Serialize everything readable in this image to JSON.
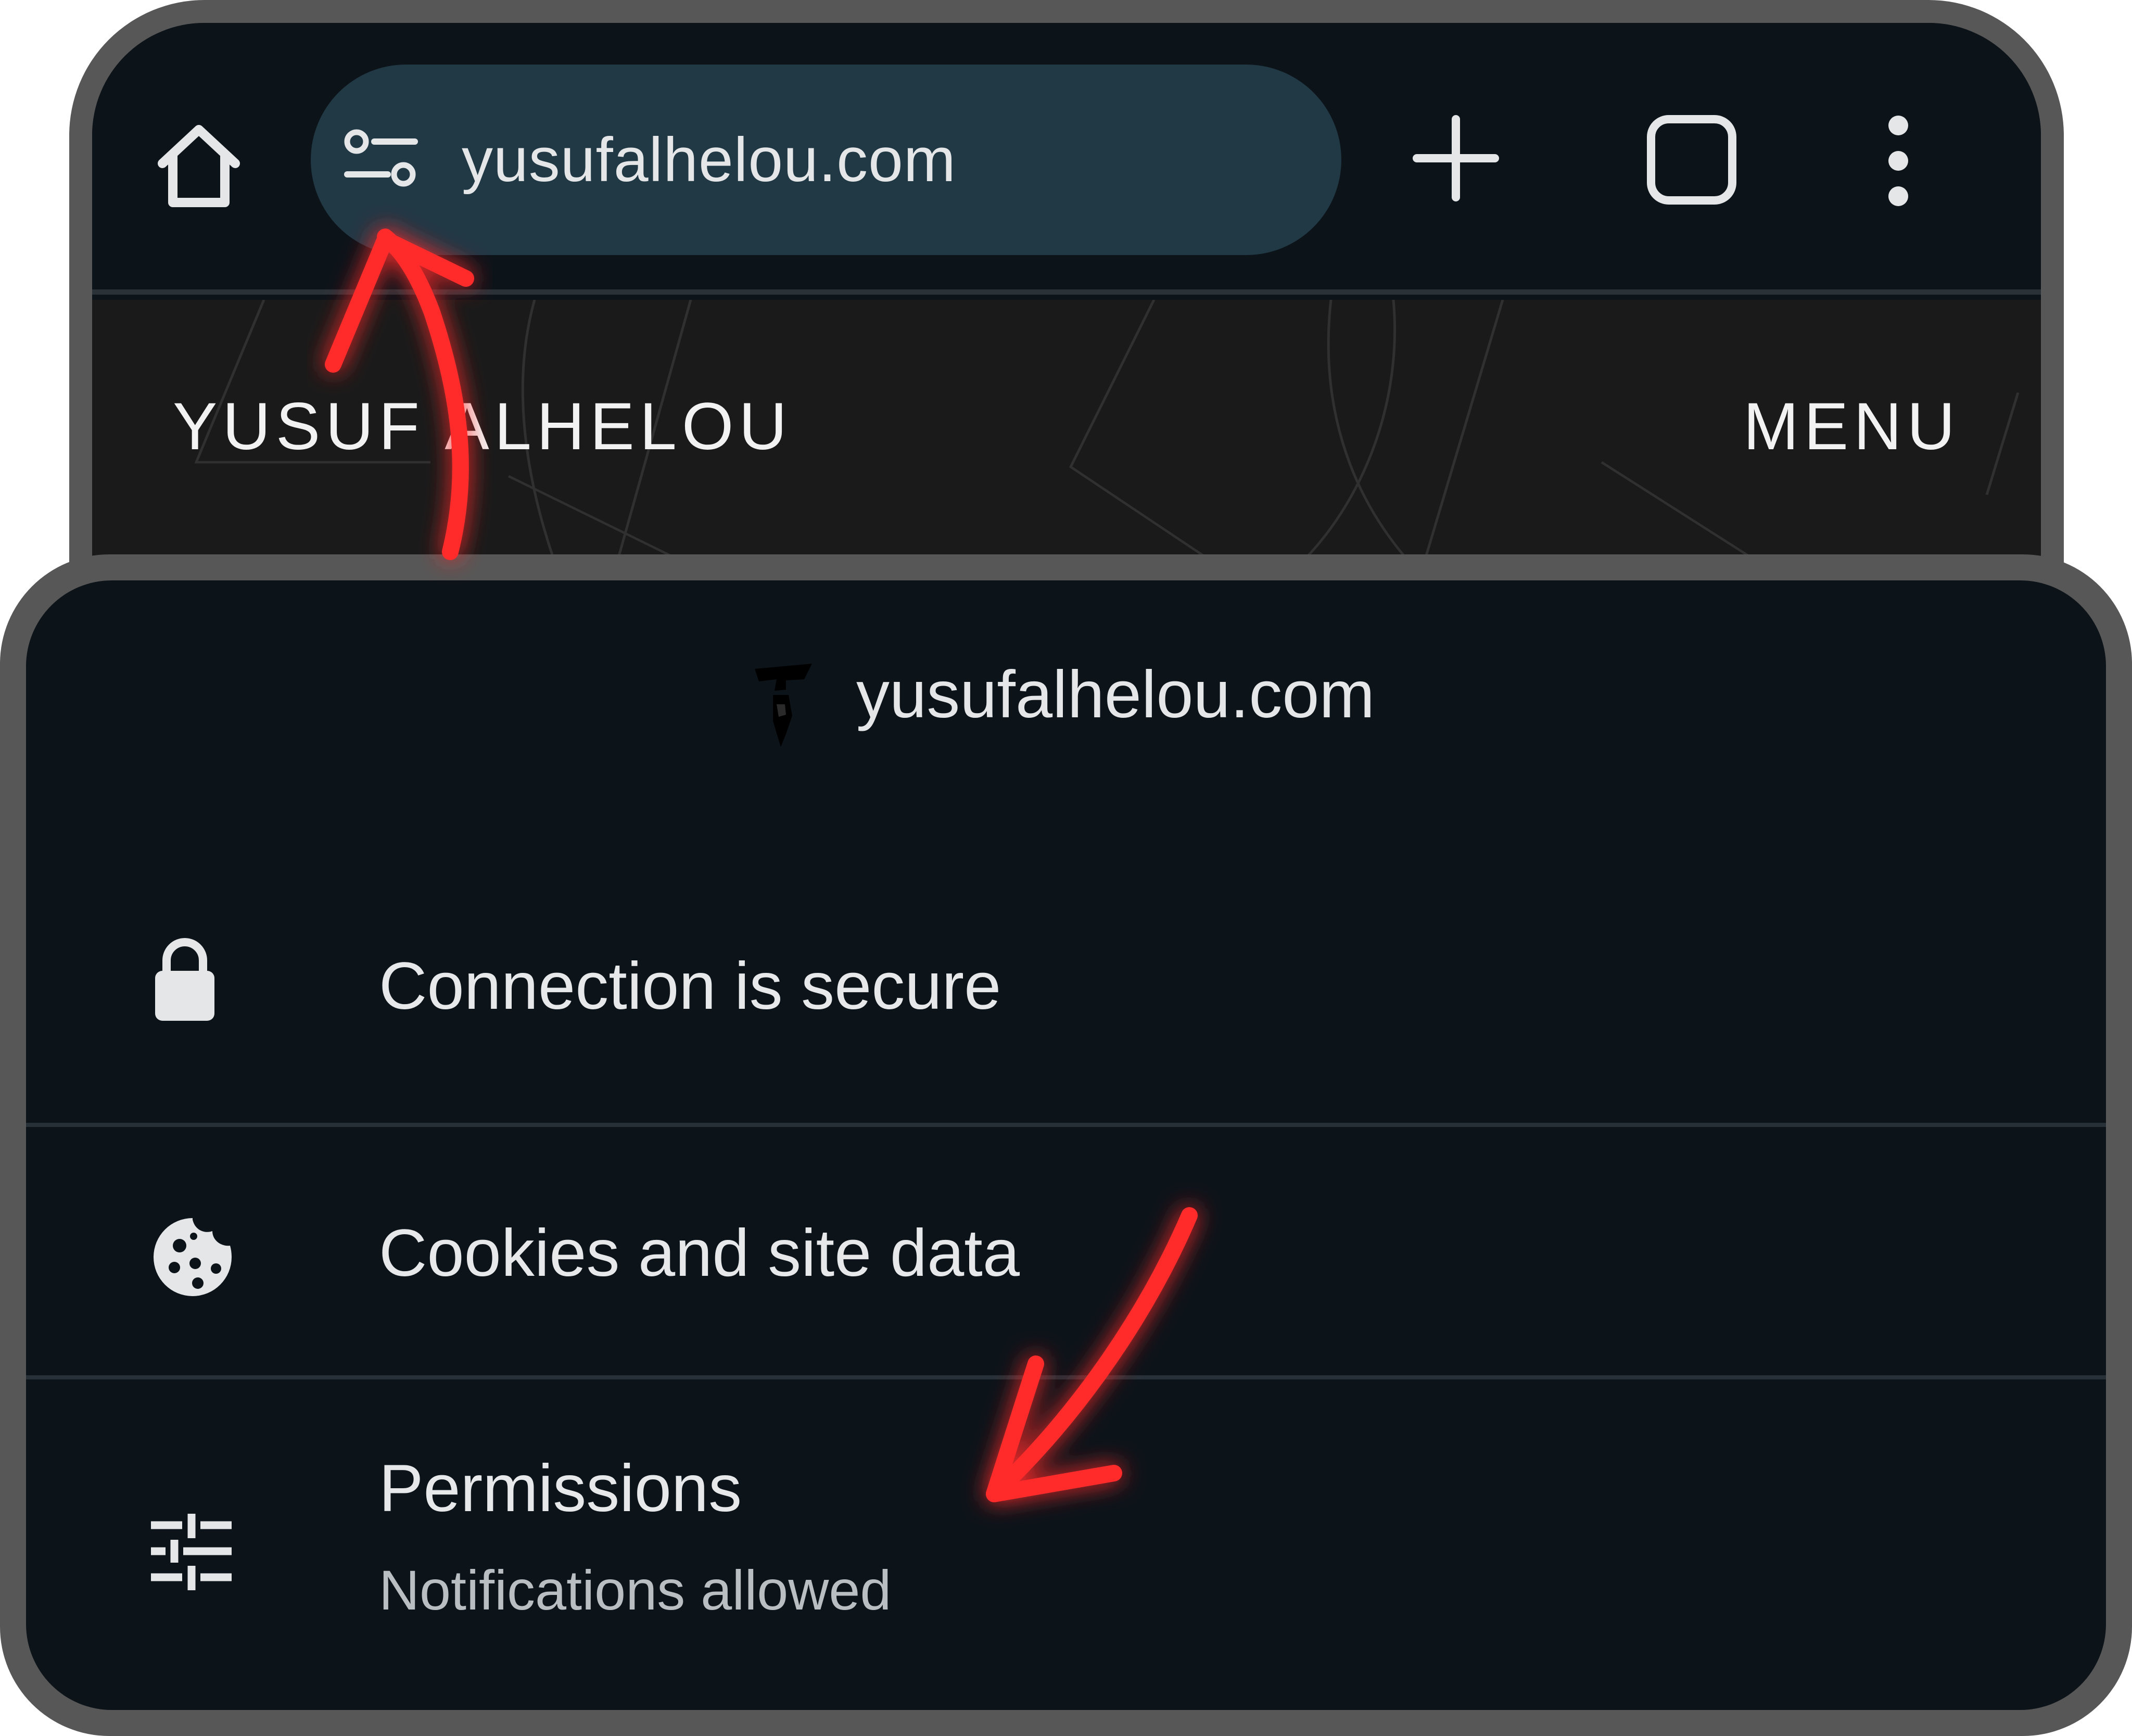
{
  "browser": {
    "url": "yusufalhelou.com",
    "icons": {
      "home": "home-icon",
      "site_settings": "tune-icon",
      "new_tab": "plus-icon",
      "tabs": "tab-switcher-icon",
      "more": "more-vert-icon"
    }
  },
  "site_header": {
    "logo_text": "YUSUF ALHELOU",
    "menu_label": "MENU"
  },
  "site_info_sheet": {
    "domain": "yusufalhelou.com",
    "favicon": "site-favicon-icon",
    "rows": [
      {
        "icon": "lock-icon",
        "label": "Connection is secure"
      },
      {
        "icon": "cookie-icon",
        "label": "Cookies and site data"
      },
      {
        "icon": "tune-sliders-icon",
        "label": "Permissions",
        "sublabel": "Notifications allowed"
      }
    ]
  },
  "annotations": {
    "color": "#ff2b2b",
    "arrows": [
      "arrow-to-site-settings",
      "arrow-to-permissions"
    ]
  },
  "colors": {
    "frame": "#575757",
    "background": "#0c1319",
    "omnibox": "#213845",
    "site_header": "#1a1a1a",
    "text": "#e6e8ea"
  }
}
